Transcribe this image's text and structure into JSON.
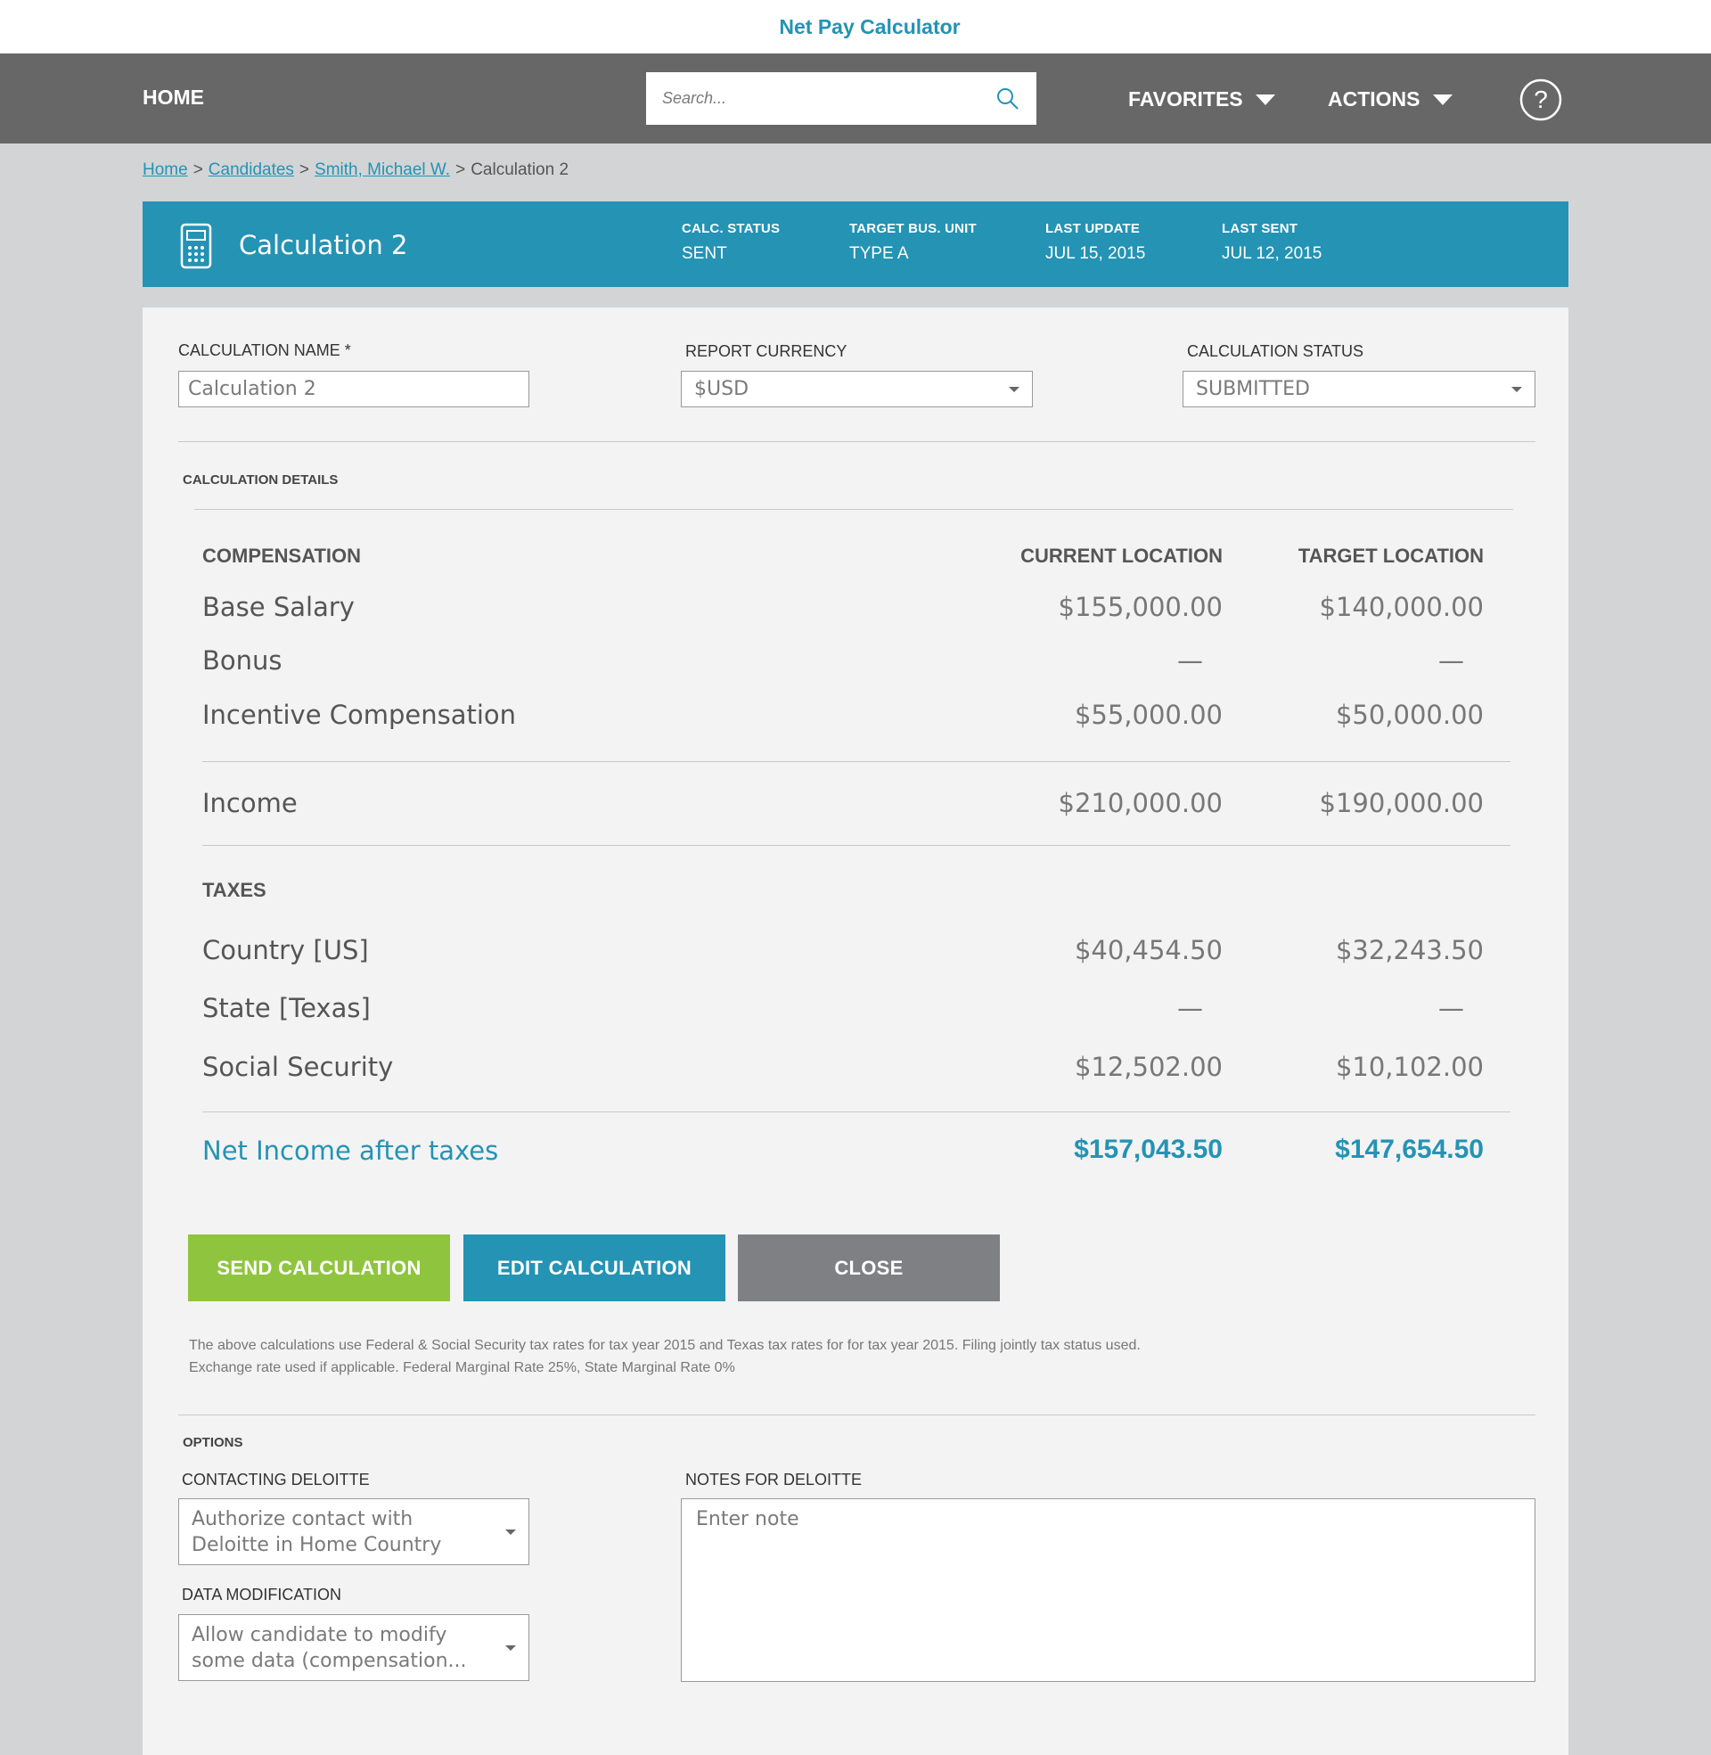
{
  "app": {
    "title": "Net Pay Calculator"
  },
  "nav": {
    "home": "HOME",
    "search_placeholder": "Search...",
    "favorites": "FAVORITES",
    "actions": "ACTIONS"
  },
  "breadcrumb": {
    "home": "Home",
    "sep1": ">",
    "candidates": "Candidates",
    "sep2": ">",
    "candidate": "Smith, Michael W.",
    "sep3": ">",
    "current": "Calculation 2"
  },
  "header": {
    "title": "Calculation 2",
    "meta": [
      {
        "label": "CALC. STATUS",
        "value": "SENT"
      },
      {
        "label": "TARGET BUS. UNIT",
        "value": "TYPE A"
      },
      {
        "label": "LAST UPDATE",
        "value": "JUL 15, 2015"
      },
      {
        "label": "LAST SENT",
        "value": "JUL 12, 2015"
      }
    ]
  },
  "form": {
    "name_label": "CALCULATION NAME *",
    "name_value": "Calculation 2",
    "currency_label": "REPORT CURRENCY",
    "currency_value": "$USD",
    "status_label": "CALCULATION STATUS",
    "status_value": "SUBMITTED"
  },
  "details": {
    "section_label": "CALCULATION DETAILS",
    "compensation_header": "COMPENSATION",
    "current_header": "CURRENT LOCATION",
    "target_header": "TARGET LOCATION",
    "compensation_rows": [
      {
        "label": "Base Salary",
        "current": "$155,000.00",
        "target": "$140,000.00"
      },
      {
        "label": "Bonus",
        "current": "—",
        "target": "—"
      },
      {
        "label": "Incentive Compensation",
        "current": "$55,000.00",
        "target": "$50,000.00"
      }
    ],
    "income": {
      "label": "Income",
      "current": "$210,000.00",
      "target": "$190,000.00"
    },
    "taxes_header": "TAXES",
    "tax_rows": [
      {
        "label": "Country [US]",
        "current": "$40,454.50",
        "target": "$32,243.50"
      },
      {
        "label": "State [Texas]",
        "current": "—",
        "target": "—"
      },
      {
        "label": "Social Security",
        "current": "$12,502.00",
        "target": "$10,102.00"
      }
    ],
    "net": {
      "label": "Net Income after taxes",
      "current": "$157,043.50",
      "target": "$147,654.50"
    }
  },
  "buttons": {
    "send": "SEND CALCULATION",
    "edit": "EDIT CALCULATION",
    "close": "CLOSE"
  },
  "disclaimer": {
    "line1": "The above calculations use Federal & Social Security tax rates for tax year 2015 and Texas tax rates for for tax year 2015. Filing jointly tax status used.",
    "line2": "Exchange rate used if applicable. Federal Marginal Rate 25%, State Marginal Rate 0%"
  },
  "options": {
    "section_label": "OPTIONS",
    "contact_label": "CONTACTING DELOITTE",
    "contact_value": "Authorize contact with Deloitte in Home Country",
    "modification_label": "DATA MODIFICATION",
    "modification_value": "Allow candidate to modify some data (compensation...",
    "notes_label": "NOTES FOR DELOITTE",
    "notes_placeholder": "Enter note"
  },
  "colors": {
    "accent": "#2493b4",
    "send": "#8fc53e",
    "close": "#7f8083",
    "nav": "#676767"
  }
}
